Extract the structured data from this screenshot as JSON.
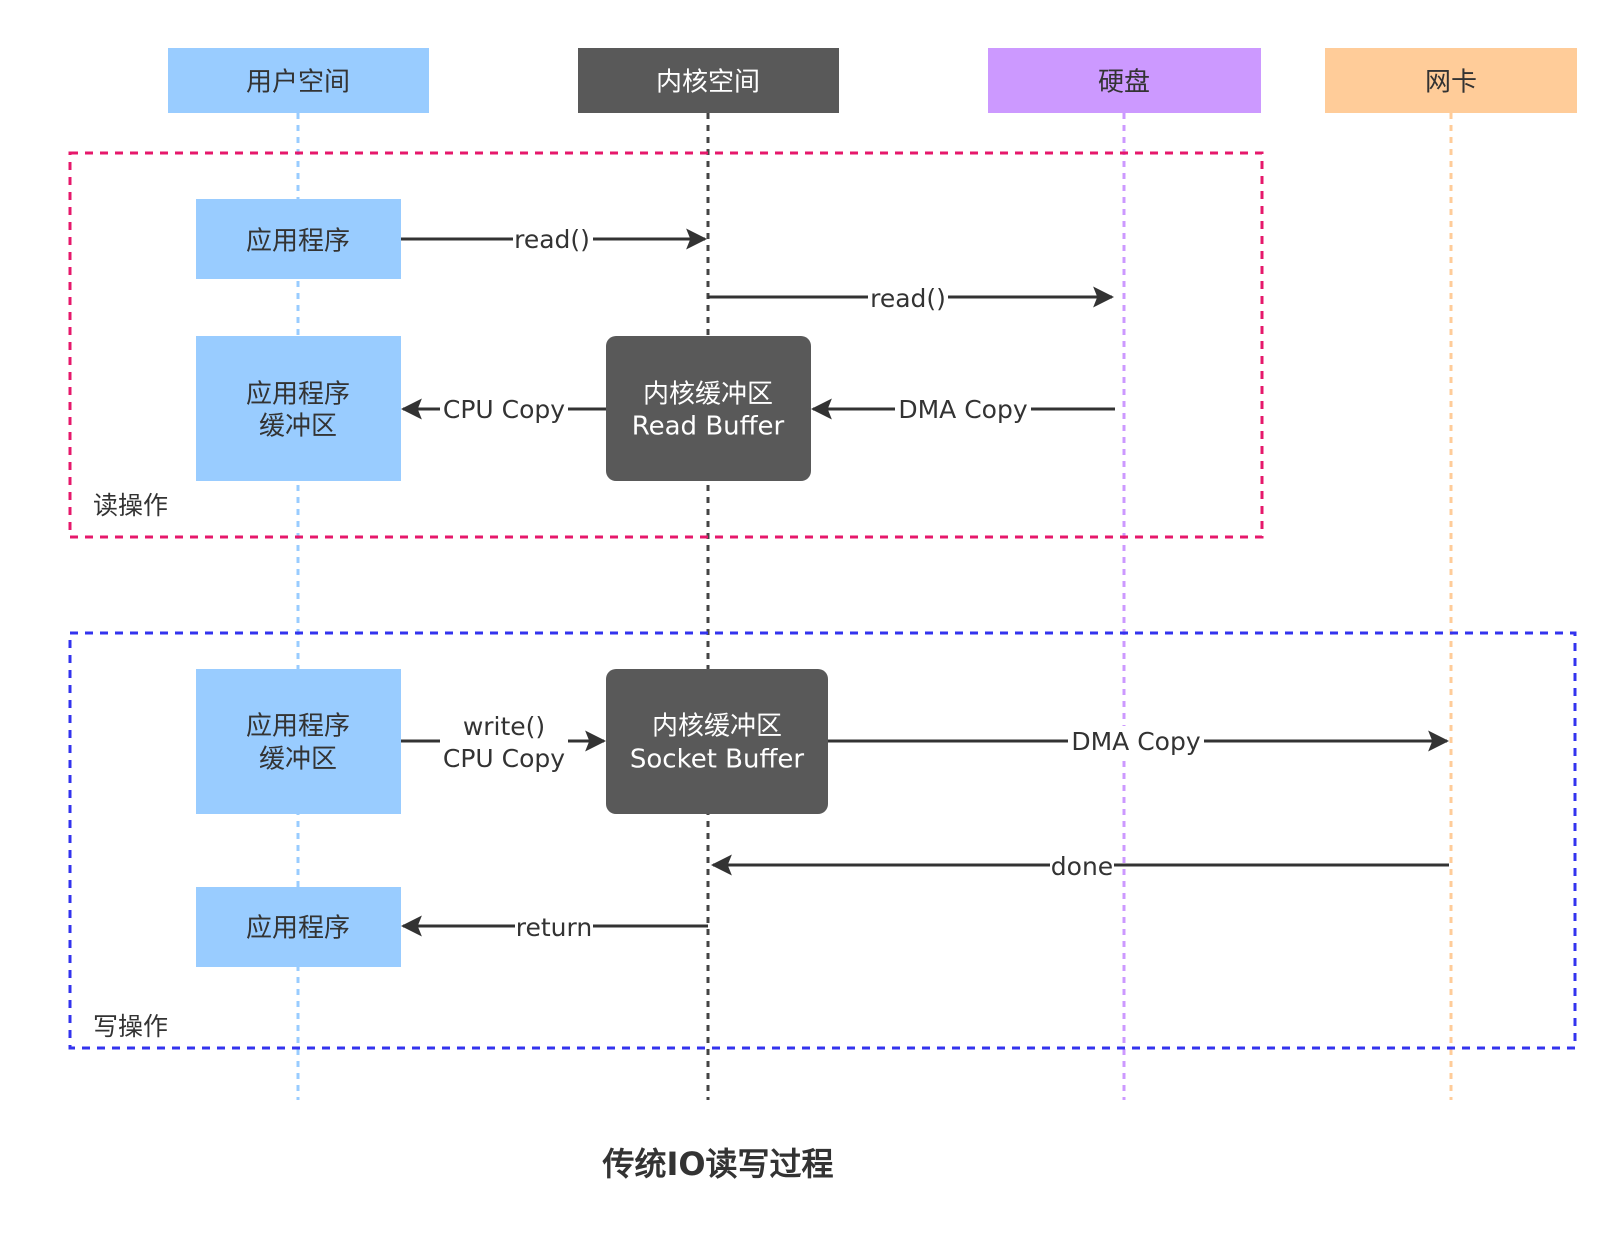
{
  "lanes": {
    "user": "用户空间",
    "kernel": "内核空间",
    "disk": "硬盘",
    "nic": "网卡"
  },
  "read_group": {
    "label": "读操作",
    "app": "应用程序",
    "app_buffer": [
      "应用程序",
      "缓冲区"
    ],
    "kernel_buffer": [
      "内核缓冲区",
      "Read Buffer"
    ],
    "read_call_1": "read()",
    "read_call_2": "read()",
    "cpu_copy": "CPU Copy",
    "dma_copy": "DMA Copy"
  },
  "write_group": {
    "label": "写操作",
    "app_buffer": [
      "应用程序",
      "缓冲区"
    ],
    "kernel_buffer": [
      "内核缓冲区",
      "Socket Buffer"
    ],
    "write_call": "write()",
    "cpu_copy": "CPU Copy",
    "dma_copy": "DMA Copy",
    "done": "done",
    "app": "应用程序",
    "return": "return"
  },
  "caption": "传统IO读写过程",
  "colors": {
    "user": "#99ccff",
    "kernel": "#595959",
    "disk": "#cc99ff",
    "nic": "#ffcc99",
    "read_border": "#e6186b",
    "write_border": "#3333ee",
    "arrow": "#333333"
  }
}
